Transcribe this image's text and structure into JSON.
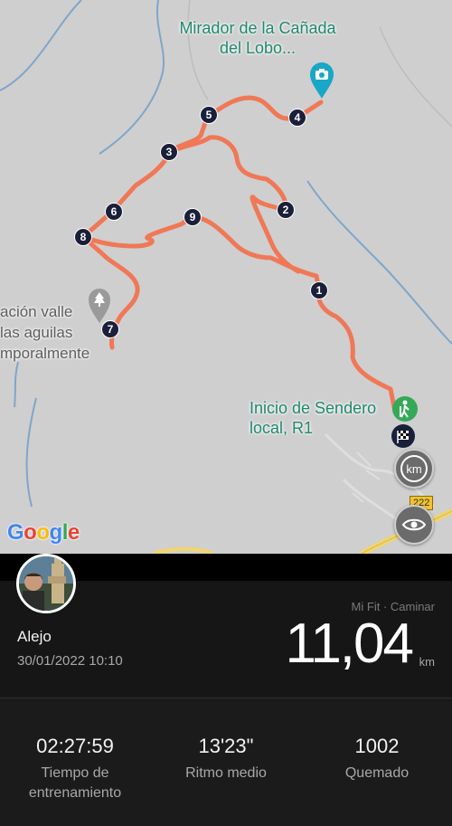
{
  "map": {
    "poi_mirador": "Mirador de la Cañada\ndel Lobo...",
    "poi_inicio": "Inicio de Sendero\nlocal, R1",
    "poi_valle": "ación valle\nlas aguilas\nmporalmente",
    "road_number": "222",
    "km_button": "km",
    "waypoints": [
      "1",
      "2",
      "3",
      "4",
      "5",
      "6",
      "7",
      "8",
      "9"
    ],
    "google_logo": "Google",
    "colors": {
      "route": "#f07856",
      "map_bg": "#cfcfcf",
      "water": "#7fa6c9",
      "poi_green": "#1e8a6e"
    },
    "icons": [
      "camera-icon",
      "hiker-icon",
      "finish-flag-icon",
      "tree-icon",
      "eye-icon"
    ]
  },
  "activity": {
    "user": "Alejo",
    "datetime": "30/01/2022 10:10",
    "source": "Mi Fit · Caminar",
    "distance": "11,04",
    "distance_unit": "km"
  },
  "stats": [
    {
      "value": "02:27:59",
      "label": "Tiempo de\nentrenamiento"
    },
    {
      "value": "13'23\"",
      "label": "Ritmo medio"
    },
    {
      "value": "1002",
      "label": "Quemado"
    }
  ]
}
